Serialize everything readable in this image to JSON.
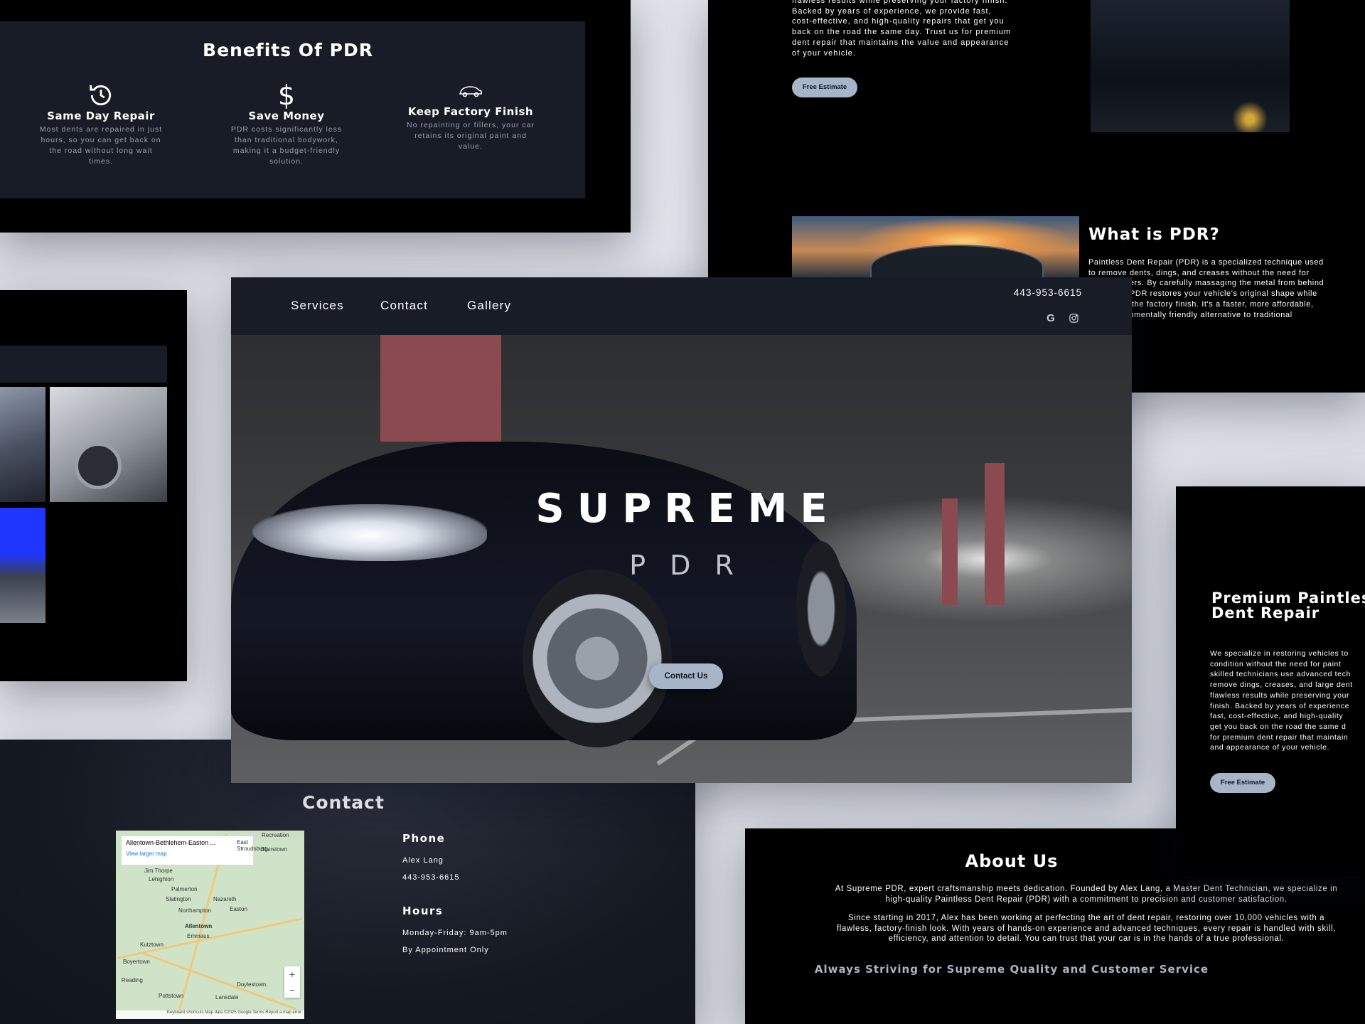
{
  "benefits": {
    "title": "Benefits Of PDR",
    "items": [
      {
        "icon": "clock-history-icon",
        "title": "Same Day Repair",
        "text": "Most dents are repaired in just hours, so you can get back on the road without long wait times."
      },
      {
        "icon": "dollar-icon",
        "title": "Save Money",
        "text": "PDR costs significantly less than traditional bodywork, making it a budget-friendly solution."
      },
      {
        "icon": "car-icon",
        "title": "Keep Factory Finish",
        "text": "No repainting or fillers, your car retains its original paint and value."
      }
    ]
  },
  "about_top": {
    "paragraph": "flawless results while preserving your factory finish. Backed by years of experience, we provide fast, cost-effective, and high-quality repairs that get you back on the road the same day. Trust us for premium dent repair that maintains the value and appearance of your vehicle.",
    "button": "Free Estimate",
    "pdr_title": "What is PDR?",
    "pdr_text": "Paintless Dent Repair (PDR) is a specialized technique used to remove dents, dings, and creases without the need for paint or fillers. By carefully massaging the metal from behind the panel, PDR restores your vehicle's original shape while preserving the factory finish. It's a faster, more affordable, and environmentally friendly alternative to traditional"
  },
  "hero": {
    "nav": [
      "Services",
      "Contact",
      "Gallery"
    ],
    "phone": "443-953-6615",
    "social_icons": [
      "google-icon",
      "instagram-icon"
    ],
    "title": "SUPREME",
    "subtitle": "PDR",
    "cta": "Contact Us"
  },
  "contact": {
    "title": "Contact",
    "map": {
      "place": "Allentown-Bethlehem-Easton ...",
      "link": "View larger map",
      "towns": [
        "Recreation",
        "East Stroudsburg",
        "Blairstown",
        "Jim Thorpe",
        "Lehighton",
        "Palmerton",
        "Slatington",
        "Nazareth",
        "Northampton",
        "Easton",
        "Allentown",
        "Emmaus",
        "Kutztown",
        "Reading",
        "Pottstown",
        "Lansdale",
        "Doylestown",
        "Boyertown"
      ],
      "footer": "Keyboard shortcuts   Map data ©2025 Google   Terms   Report a map error"
    },
    "phone_label": "Phone",
    "name": "Alex Lang",
    "phone": "443-953-6615",
    "hours_label": "Hours",
    "hours": "Monday-Friday: 9am-5pm",
    "appointment": "By Appointment Only"
  },
  "about_bottom": {
    "title": "About Us",
    "p1": "At Supreme PDR, expert craftsmanship meets dedication. Founded by Alex Lang, a Master Dent Technician, we specialize in high-quality Paintless Dent Repair (PDR) with a commitment to precision and customer satisfaction.",
    "p2": "Since starting in 2017, Alex has been working at perfecting the art of dent repair, restoring over 10,000 vehicles with a flawless, factory-finish look. With years of hands-on experience and advanced techniques, every repair is handled with skill, efficiency, and attention to detail. You can trust that your car is in the hands of a true professional.",
    "tagline": "Always Striving for Supreme Quality and Customer Service"
  },
  "premium": {
    "title": "Premium Paintless Dent Repair",
    "paragraph": "We specialize in restoring vehicles to\ncondition without the need for paint\nskilled technicians use advanced tech\nremove dings, creases, and large dent\nflawless results while preserving your\nfinish. Backed by years of experience\nfast, cost-effective, and high-quality\nget you back on the road the same d\nfor premium dent repair that maintain\nand appearance of your vehicle.",
    "button": "Free Estimate"
  },
  "colors": {
    "accent": "#a7b5c8",
    "panel": "#181c26",
    "background": "#000000"
  }
}
